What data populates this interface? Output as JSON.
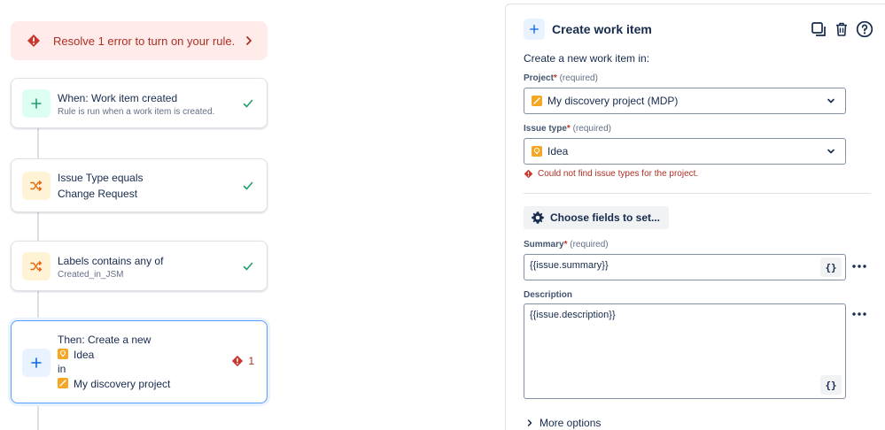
{
  "banner": {
    "text": "Resolve 1 error to turn on your rule."
  },
  "rule": {
    "trigger": {
      "title": "When: Work item created",
      "subtitle": "Rule is run when a work item is created."
    },
    "condition1": {
      "line1": "Issue Type equals",
      "line2": "Change Request"
    },
    "condition2": {
      "title": "Labels contains any of",
      "subtitle": "Created_in_JSM"
    },
    "action": {
      "line1": "Then: Create a new",
      "type": "Idea",
      "in": "in",
      "project": "My discovery project",
      "error_count": "1"
    }
  },
  "panel": {
    "title": "Create work item",
    "intro": "Create a new work item in:",
    "project": {
      "label": "Project",
      "required_mark": "*",
      "required_text": "(required)",
      "value": "My discovery project (MDP)"
    },
    "issue_type": {
      "label": "Issue type",
      "required_mark": "*",
      "required_text": "(required)",
      "value": "Idea",
      "error": "Could not find issue types for the project."
    },
    "choose_fields": "Choose fields to set...",
    "summary": {
      "label": "Summary",
      "required_mark": "*",
      "required_text": "(required)",
      "value": "{{issue.summary}}"
    },
    "description": {
      "label": "Description",
      "value": "{{issue.description}}"
    },
    "smart_value_button": "{}",
    "more_options": "More options"
  },
  "icons": {
    "banner": "error-icon",
    "banner_chevron": "chevron-right-icon",
    "trigger": "plus-icon",
    "condition": "shuffle-icon",
    "action": "plus-icon",
    "check": "check-icon",
    "duplicate": "copy-icon",
    "delete": "trash-icon",
    "help": "help-icon",
    "settings": "gear-icon",
    "dropdown": "chevron-down-icon",
    "more": "more-horizontal-icon"
  },
  "colors": {
    "error": "#ae2e24",
    "error_bg": "#ffecea",
    "success": "#22a06b",
    "accent": "#0c66e4",
    "condition": "#e56910",
    "focus_border": "#579dff"
  }
}
